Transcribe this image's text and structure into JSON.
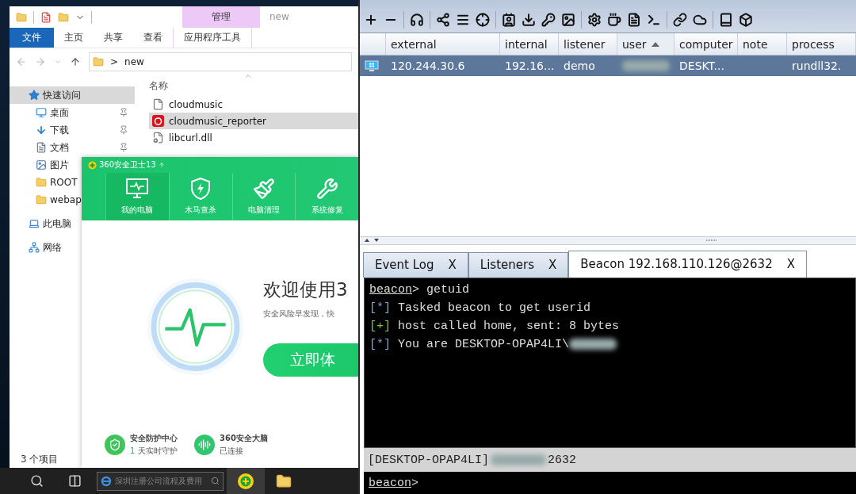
{
  "explorer": {
    "context_tab": "管理",
    "title": "new",
    "ribbon_tabs": [
      {
        "label": "文件",
        "selected": true
      },
      {
        "label": "主页",
        "selected": false
      },
      {
        "label": "共享",
        "selected": false
      },
      {
        "label": "查看",
        "selected": false
      },
      {
        "label": "应用程序工具",
        "selected": false
      }
    ],
    "address": {
      "separator": ">",
      "path": "new"
    },
    "nav": [
      {
        "label": "快速访问",
        "kind": "star",
        "selected": true,
        "children": [
          {
            "label": "桌面",
            "kind": "desktop",
            "selected": false,
            "pinned": true
          },
          {
            "label": "下载",
            "kind": "download",
            "selected": false,
            "pinned": true
          },
          {
            "label": "文档",
            "kind": "document",
            "selected": false,
            "pinned": true
          },
          {
            "label": "图片",
            "kind": "picture",
            "selected": false
          },
          {
            "label": "ROOT",
            "kind": "folder",
            "selected": false
          },
          {
            "label": "webap",
            "kind": "folder",
            "selected": false
          }
        ]
      },
      {
        "label": "此电脑",
        "kind": "pc",
        "selected": false
      },
      {
        "label": "网络",
        "kind": "network",
        "selected": false
      }
    ],
    "column_header": "名称",
    "files": [
      {
        "name": "cloudmusic",
        "kind": "app",
        "selected": false
      },
      {
        "name": "cloudmusic_reporter",
        "kind": "music",
        "selected": true
      },
      {
        "name": "libcurl.dll",
        "kind": "dll",
        "selected": false
      }
    ],
    "status": "3 个项目"
  },
  "security_app": {
    "title": "360安全卫士13",
    "nav": [
      {
        "label": "我的电脑",
        "kind": "monitor",
        "selected": true
      },
      {
        "label": "木马查杀",
        "kind": "shield",
        "selected": false
      },
      {
        "label": "电脑清理",
        "kind": "broom",
        "selected": false
      },
      {
        "label": "系统修复",
        "kind": "wrench",
        "selected": false
      }
    ],
    "headline": "欢迎使用3",
    "subtitle": "安全风险早发现，快",
    "cta": "立即体",
    "footer": [
      {
        "kind": "shield",
        "title": "安全防护中心",
        "count": "1",
        "line": "天实时守护"
      },
      {
        "kind": "brain",
        "title": "360安全大脑",
        "line": "已连接"
      }
    ]
  },
  "taskbar": {
    "search_placeholder": "深圳注册公司流程及费用"
  },
  "cobalt": {
    "table": {
      "columns": [
        {
          "label": "external",
          "sorted": false
        },
        {
          "label": "internal",
          "sorted": false
        },
        {
          "label": "listener",
          "sorted": false
        },
        {
          "label": "user",
          "sorted": true
        },
        {
          "label": "computer",
          "sorted": false
        },
        {
          "label": "note",
          "sorted": false
        },
        {
          "label": "process",
          "sorted": false
        }
      ],
      "rows": [
        {
          "selected": true,
          "cells": [
            {
              "text": "120.244.30.6"
            },
            {
              "text": "192.16..."
            },
            {
              "text": "demo"
            },
            {
              "redacted": true
            },
            {
              "text": "DESKT..."
            },
            {},
            {
              "text": "rundll32."
            }
          ]
        }
      ]
    },
    "tabs": [
      {
        "label": "Event Log",
        "close": "X",
        "selected": false
      },
      {
        "label": "Listeners",
        "close": "X",
        "selected": false
      },
      {
        "label": "Beacon 192.168.110.126@2632",
        "close": "X",
        "selected": true
      }
    ],
    "console": [
      {
        "kind": "command",
        "prompt": "beacon",
        "sign": ">",
        "text": "getuid"
      },
      {
        "kind": "info",
        "marker": "[*]",
        "text": "Tasked beacon to get userid"
      },
      {
        "kind": "success",
        "marker": "[+]",
        "text": "host called home, sent: 8 bytes"
      },
      {
        "kind": "info",
        "marker": "[*]",
        "text": "You are DESKTOP-OPAP4LI\\",
        "redacted": true
      }
    ],
    "status": {
      "host": "[DESKTOP-OPAP4LI]",
      "redacted": true,
      "pid": "2632"
    },
    "input": {
      "prompt": "beacon",
      "sign": ">"
    }
  }
}
